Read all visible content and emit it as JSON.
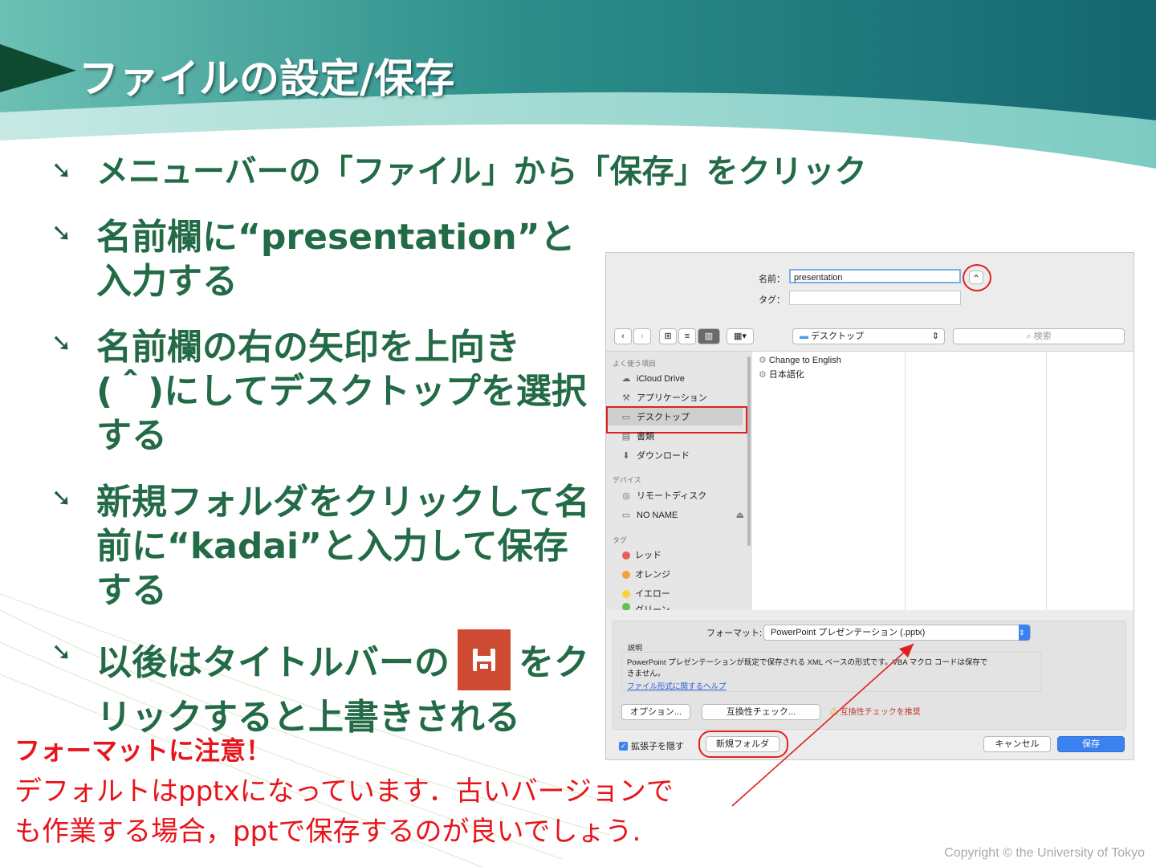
{
  "slide": {
    "title": "ファイルの設定/保存",
    "bullet_marker": "➘",
    "bullets": [
      {
        "text": "メニューバーの「ファイル」から「保存」をクリック"
      },
      {
        "line1": "名前欄に“presentation”と",
        "line2": "入力する"
      },
      {
        "line1": "名前欄の右の矢印を上向き",
        "line2": "(＾)にしてデスクトップを選択",
        "line3": "する"
      },
      {
        "line1": "新規フォルダをクリックして名",
        "line2": "前に“kadai”と入力して保存",
        "line3": "する"
      },
      {
        "before_icon": "以後はタイトルバーの",
        "after_icon": "をク",
        "line2": "リックすると上書きされる",
        "icon": "save-icon"
      }
    ],
    "note_heading": "フォーマットに注意！",
    "note_line1": "デフォルトはpptxになっています．古いバージョンで",
    "note_line2": "も作業する場合，pptで保存するのが良いでしょう.",
    "copyright": "Copyright © the University of Tokyo",
    "colors": {
      "title_band": "#1d7a7a",
      "bullet_text": "#236b46",
      "note": "#e8141b",
      "highlight_ring": "#e02020"
    }
  },
  "dialog": {
    "name_label": "名前：",
    "name_value": "presentation",
    "tag_label": "タグ：",
    "expand_button": "⌃",
    "location": "デスクトップ",
    "search_placeholder": "検索",
    "sidebar": {
      "favorites_header": "よく使う項目",
      "favorites": [
        {
          "label": "iCloud Drive",
          "icon": "☁"
        },
        {
          "label": "アプリケーション",
          "icon": "⚒"
        },
        {
          "label": "デスクトップ",
          "icon": "▭"
        },
        {
          "label": "書類",
          "icon": "▤"
        },
        {
          "label": "ダウンロード",
          "icon": "⬇"
        }
      ],
      "devices_header": "デバイス",
      "devices": [
        {
          "label": "リモートディスク",
          "icon": "◎"
        },
        {
          "label": "NO NAME",
          "icon": "▭",
          "eject": "⏏"
        }
      ],
      "tags_header": "タグ",
      "tags": [
        {
          "label": "レッド",
          "color": "#ec5b55"
        },
        {
          "label": "オレンジ",
          "color": "#f3a33a"
        },
        {
          "label": "イエロー",
          "color": "#f5d33c"
        },
        {
          "label": "グリーン",
          "color": "#5cc453"
        }
      ]
    },
    "files": [
      {
        "label": "Change to English"
      },
      {
        "label": "日本語化"
      }
    ],
    "format_label": "フォーマット:",
    "format_value": "PowerPoint プレゼンテーション (.pptx)",
    "description_label": "説明",
    "description_text1": "PowerPoint プレゼンテーションが既定で保存される XML ベースの形式です。VBA マクロ コードは保存で",
    "description_text2": "きません。",
    "help_link": "ファイル形式に関するヘルプ",
    "options_button": "オプション...",
    "compat_button": "互換性チェック...",
    "compat_warning": "互換性チェックを推奨",
    "hide_ext_label": "拡張子を隠す",
    "new_folder_button": "新規フォルダ",
    "cancel_button": "キャンセル",
    "save_button": "保存"
  }
}
